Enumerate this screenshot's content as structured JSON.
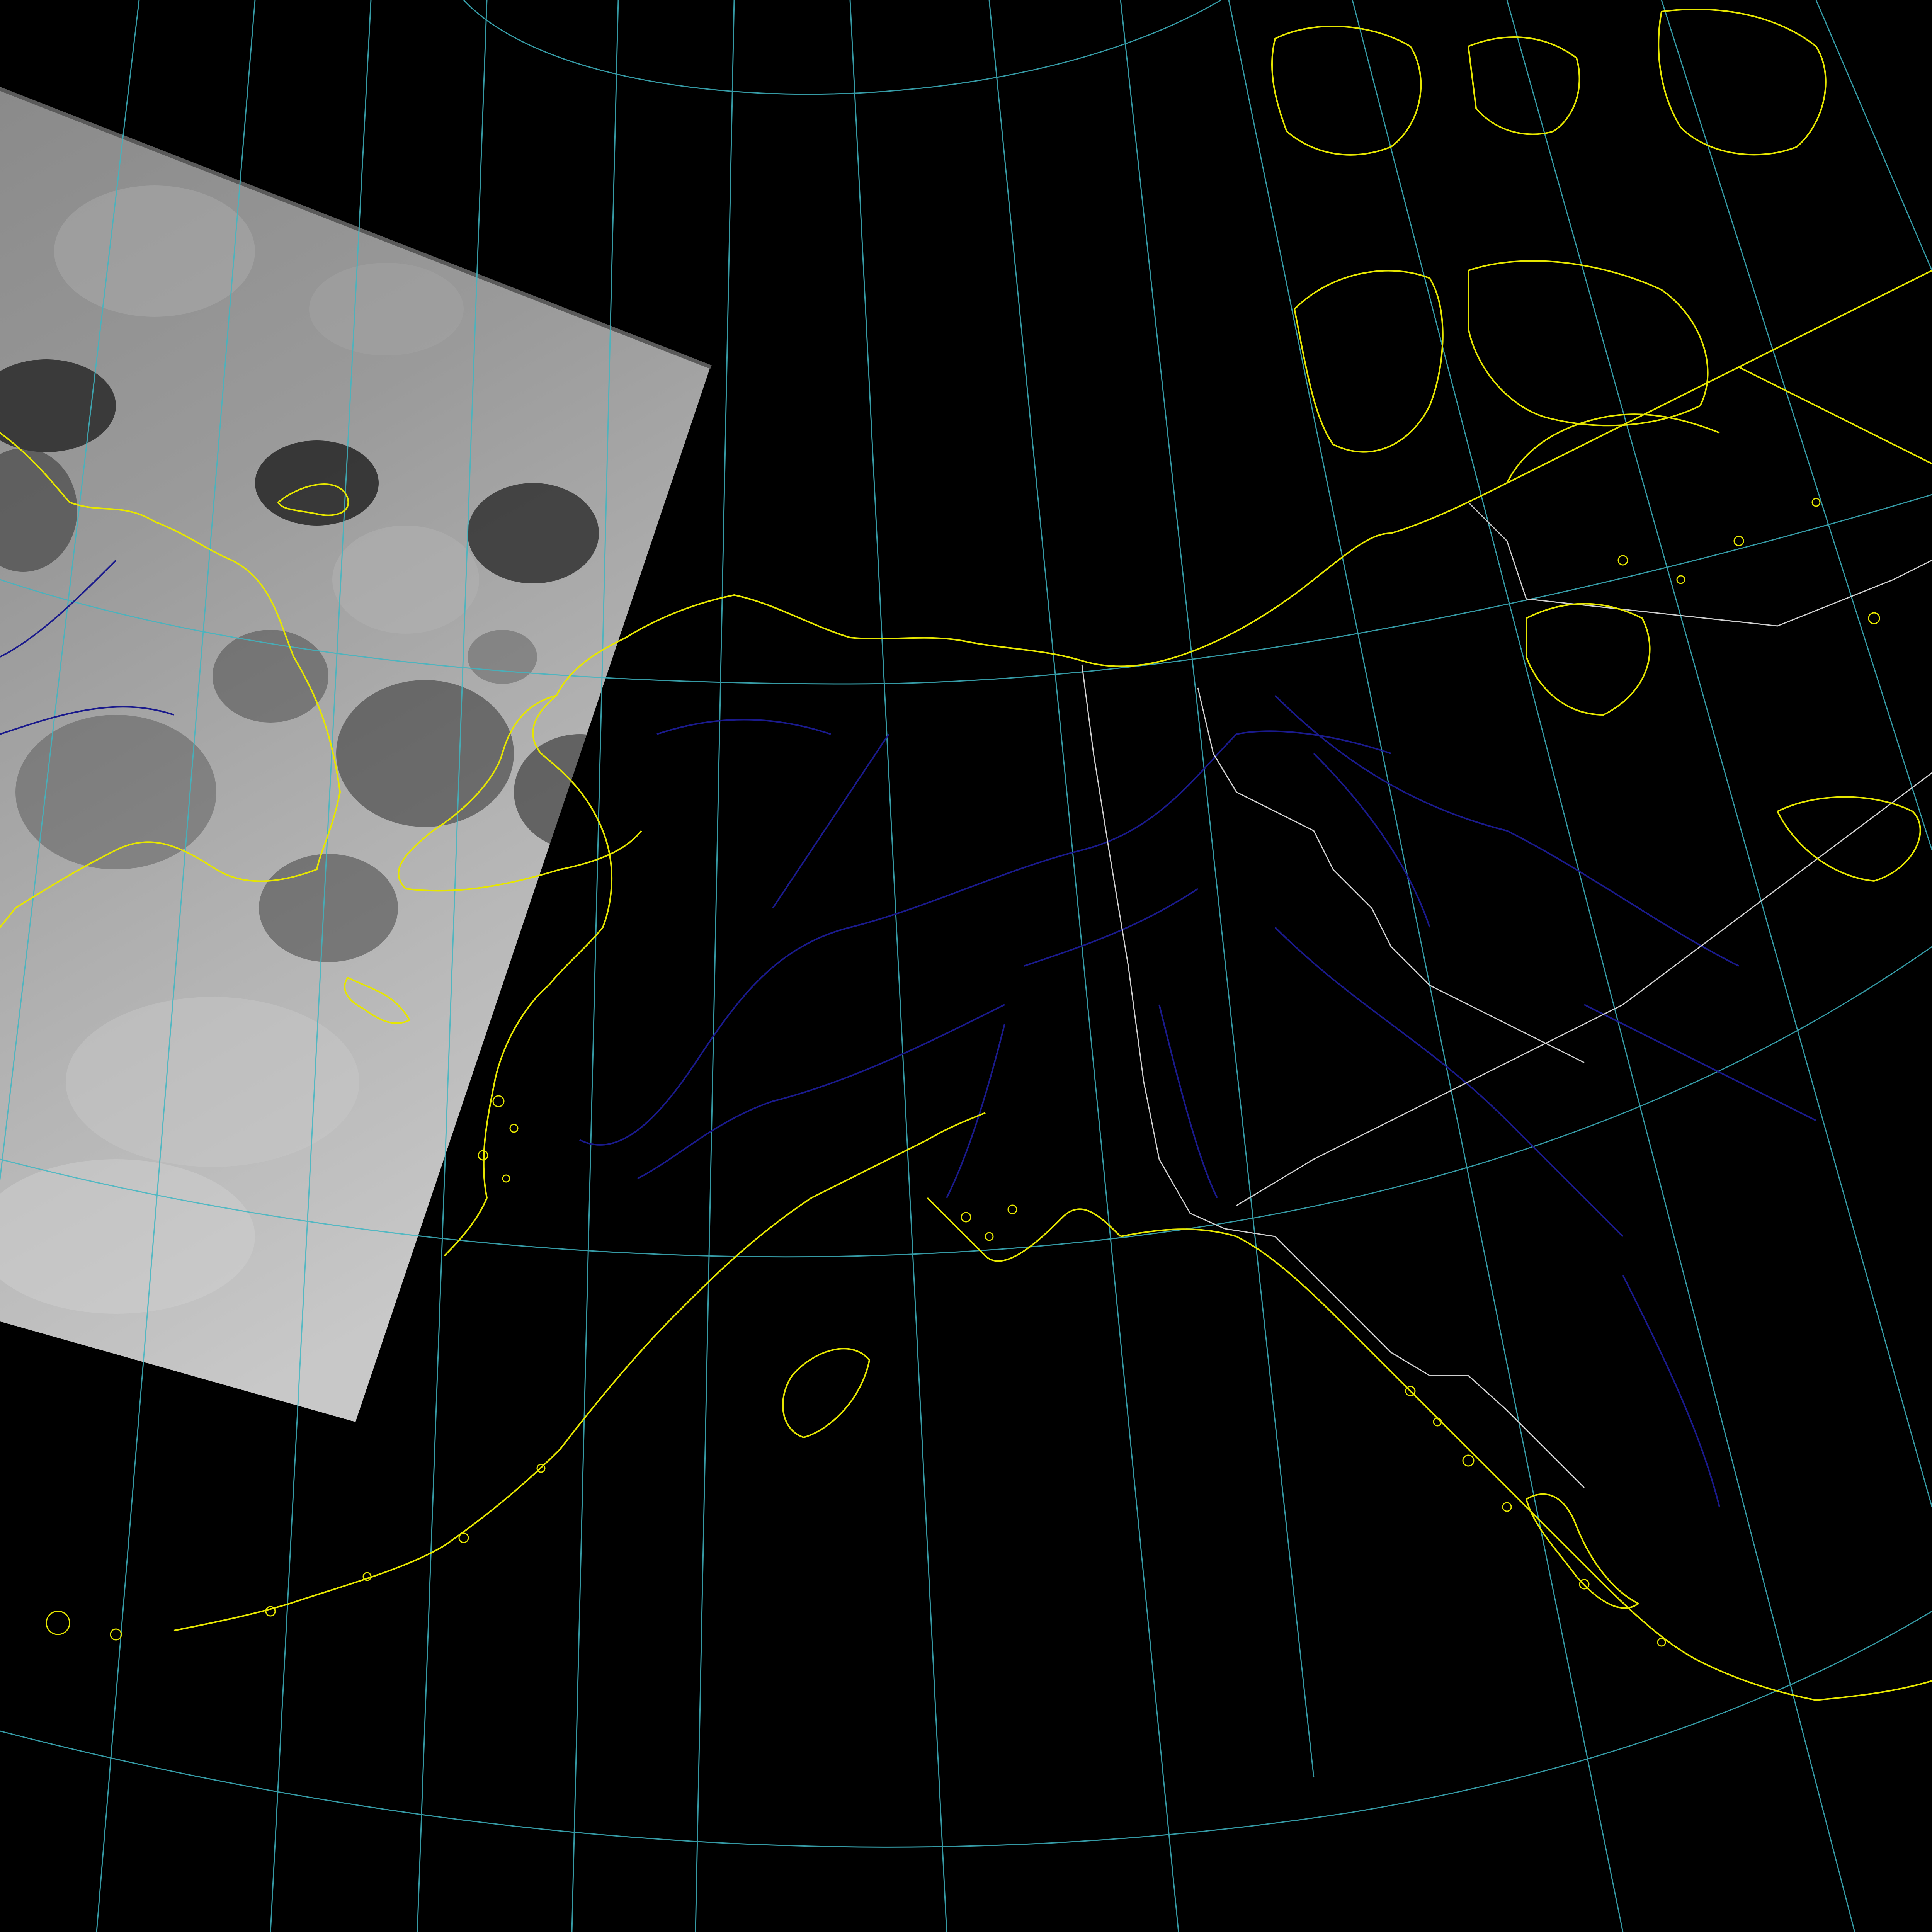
{
  "map": {
    "projection": "polar-stereographic",
    "region": "alaska-bering-strait-yukon",
    "background_color": "#000000",
    "colors": {
      "graticule": "#3fb6c2",
      "coastline": "#e6e600",
      "coastline_dim": "#b8b800",
      "rivers": "#1a1a8c",
      "rivers_bright": "#2a2ab0",
      "borders": "#d0d0d0",
      "imagery_dark": "#2e2e2e",
      "imagery_light": "#c4c4c4"
    },
    "layers": [
      {
        "name": "satellite-imagery-swath",
        "visible": true
      },
      {
        "name": "graticule",
        "visible": true
      },
      {
        "name": "coastlines",
        "visible": true
      },
      {
        "name": "rivers",
        "visible": true
      },
      {
        "name": "political-borders",
        "visible": true
      }
    ]
  }
}
